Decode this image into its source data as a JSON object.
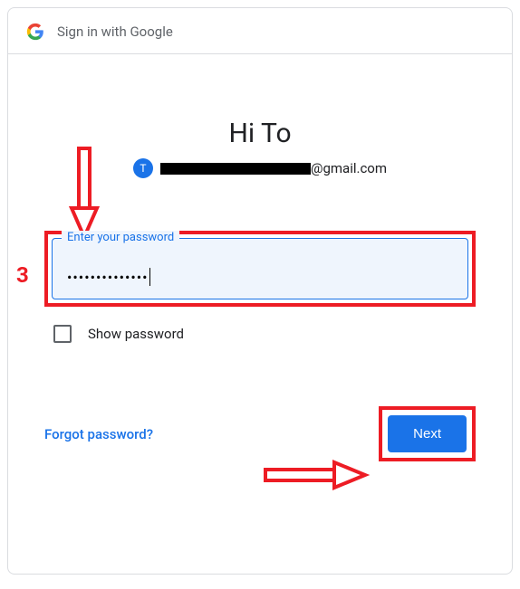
{
  "header": {
    "title": "Sign in with Google"
  },
  "greeting": "Hi To",
  "account": {
    "avatar_letter": "T",
    "email_domain": "@gmail.com"
  },
  "password_field": {
    "label": "Enter your password",
    "value_masked": "••••••••••••••"
  },
  "show_password": {
    "label": "Show password",
    "checked": false
  },
  "forgot_link": "Forgot password?",
  "next_button": "Next",
  "annotations": {
    "step_number": "3"
  }
}
